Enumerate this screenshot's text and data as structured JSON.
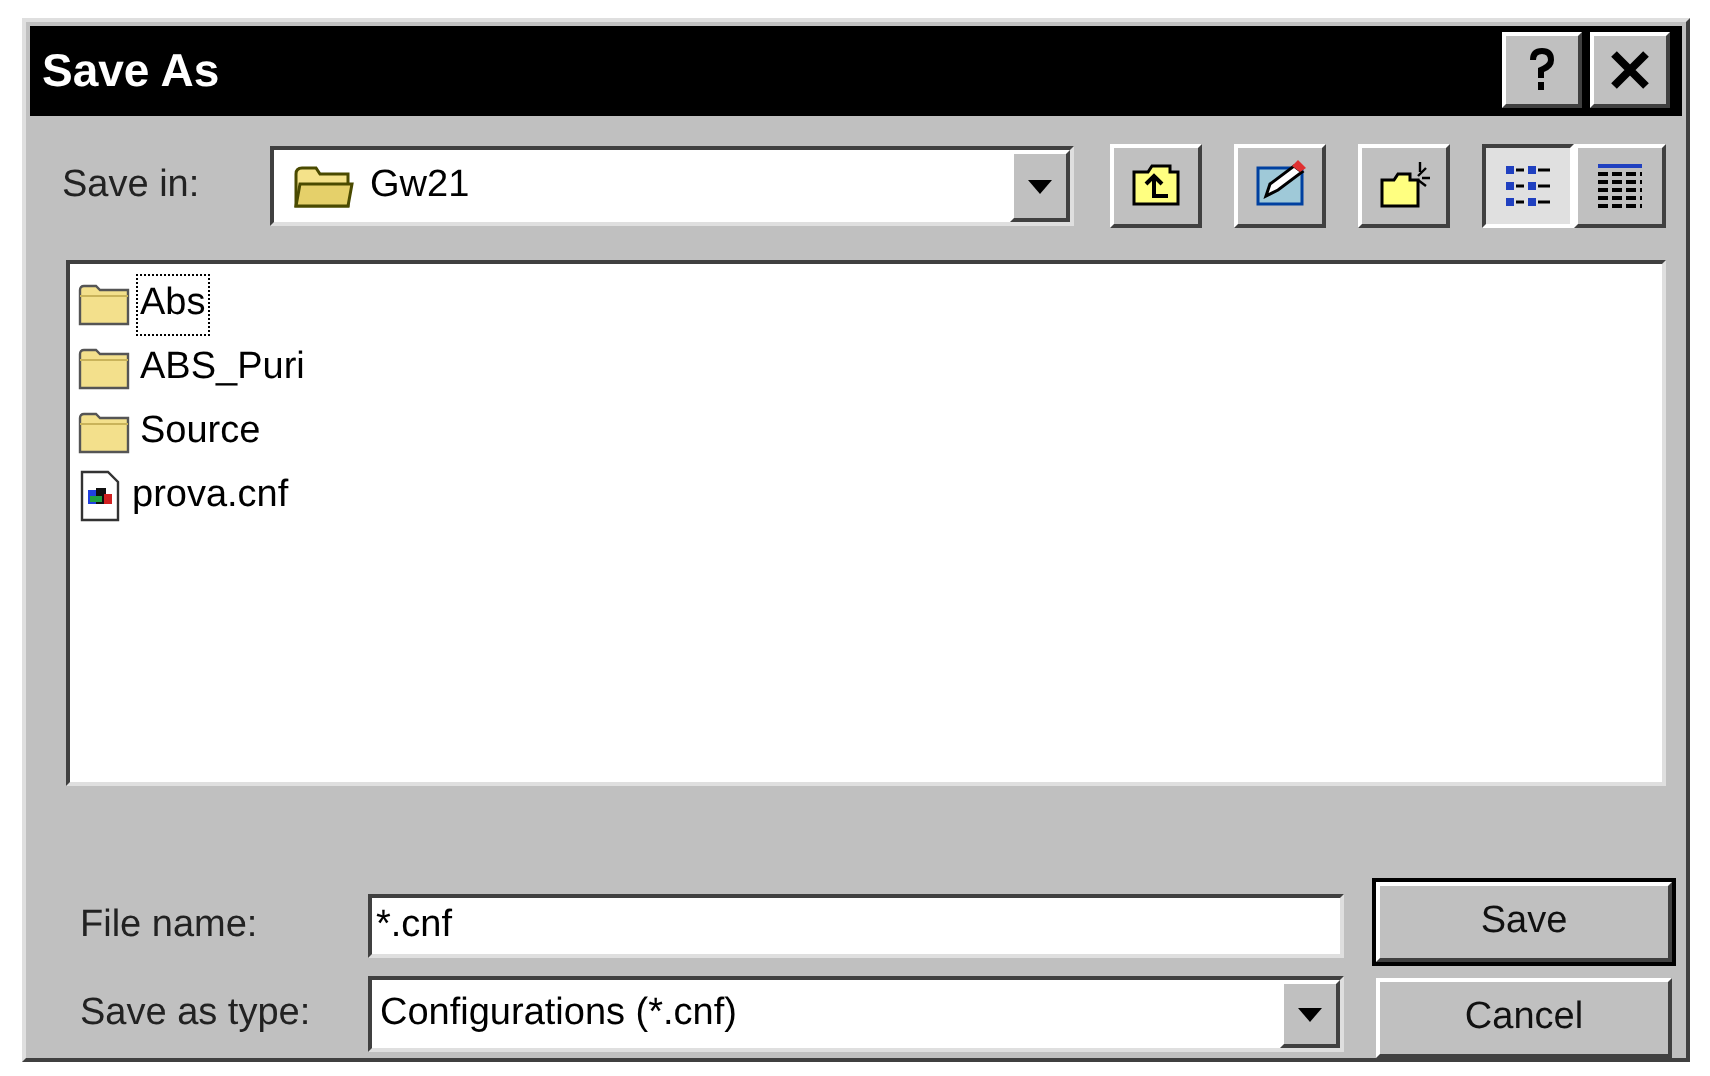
{
  "window": {
    "title": "Save As"
  },
  "save_in": {
    "label": "Save in:",
    "value": "Gw21"
  },
  "toolbar": [
    {
      "kind": "up"
    },
    {
      "kind": "desktop"
    },
    {
      "kind": "new_folder"
    },
    {
      "kind": "list",
      "selected": true
    },
    {
      "kind": "details",
      "selected": false
    }
  ],
  "files": [
    {
      "name": "Abs",
      "kind": "folder",
      "focused": true
    },
    {
      "name": "ABS_Puri",
      "kind": "folder",
      "focused": false
    },
    {
      "name": "Source",
      "kind": "folder",
      "focused": false
    },
    {
      "name": "prova.cnf",
      "kind": "file",
      "focused": false
    }
  ],
  "file_name": {
    "label": "File name:",
    "value": "*.cnf"
  },
  "save_as_type": {
    "label": "Save as type:",
    "value": "Configurations (*.cnf)"
  },
  "buttons": [
    {
      "label": "Save",
      "default": true
    },
    {
      "label": "Cancel",
      "default": false
    }
  ]
}
